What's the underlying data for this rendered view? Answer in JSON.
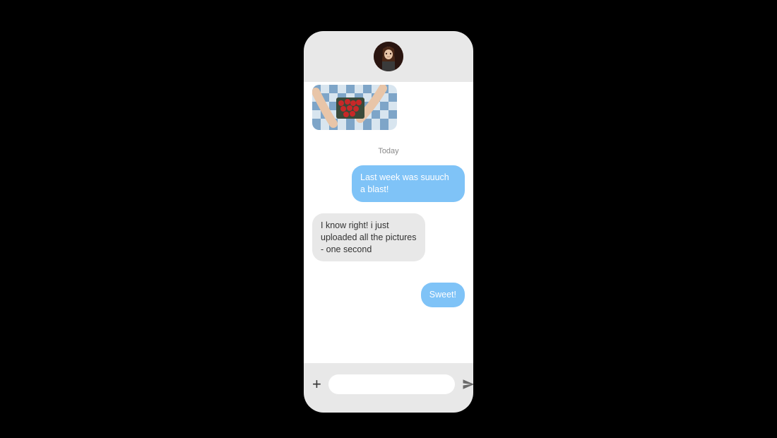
{
  "date_label": "Today",
  "messages": {
    "sent1": "Last week was suuuch a blast!",
    "received1": "I know right! i just uploaded all the pictures - one second",
    "sent2": "Sweet!"
  },
  "composer": {
    "placeholder": ""
  },
  "colors": {
    "sent_bg": "#7fc3f7",
    "received_bg": "#e8e8e8"
  },
  "icons": {
    "add": "plus-icon",
    "send": "paper-plane-icon"
  }
}
